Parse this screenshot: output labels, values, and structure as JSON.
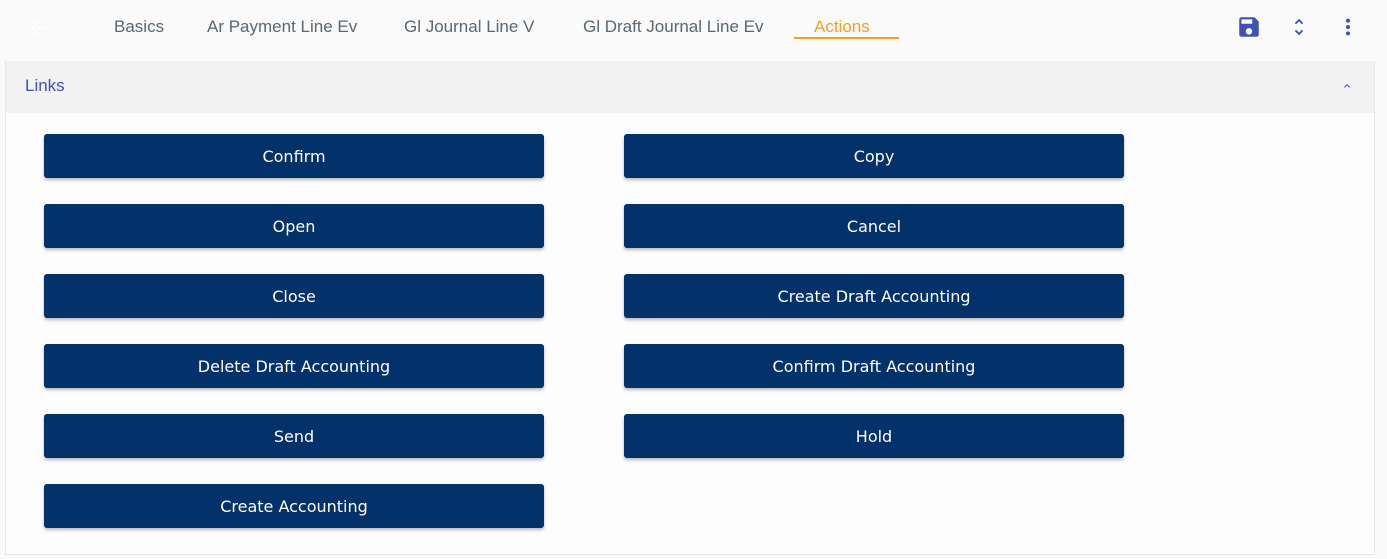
{
  "tabs": [
    {
      "label": "Basics",
      "active": false
    },
    {
      "label": "Ar Payment Line Ev",
      "active": false
    },
    {
      "label": "Gl Journal Line V",
      "active": false
    },
    {
      "label": "Gl Draft Journal Line Ev",
      "active": false
    },
    {
      "label": "Actions",
      "active": true
    }
  ],
  "toolbar": {
    "back_icon": "arrow-left-icon",
    "save_icon": "floppy-disk-icon",
    "expand_icon": "unfold-icon",
    "more_icon": "more-vertical-icon"
  },
  "section": {
    "title": "Links",
    "collapse_icon": "chevron-up-icon"
  },
  "actions": {
    "left": [
      "Confirm",
      "Open",
      "Close",
      "Delete Draft Accounting",
      "Send",
      "Create Accounting"
    ],
    "right": [
      "Copy",
      "Cancel",
      "Create Draft Accounting",
      "Confirm Draft Accounting",
      "Hold"
    ]
  },
  "colors": {
    "button_bg": "#03316a",
    "active_tab": "#f4a01c",
    "accent": "#3f51b5",
    "tab_text": "#5a6770"
  }
}
